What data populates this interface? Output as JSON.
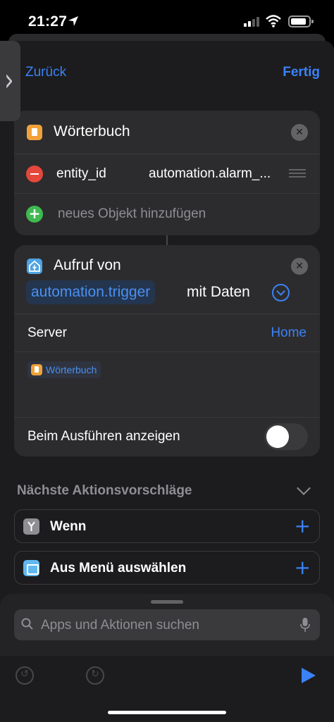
{
  "status_bar": {
    "time": "21:27"
  },
  "nav": {
    "back_label": "Zurück",
    "done_label": "Fertig"
  },
  "dictionary_card": {
    "title": "Wörterbuch",
    "entries": [
      {
        "key": "entity_id",
        "value": "automation.alarm_..."
      }
    ],
    "add_label": "neues Objekt hinzufügen"
  },
  "call_card": {
    "title": "Aufruf von",
    "service": "automation.trigger",
    "suffix": "mit Daten",
    "server_label": "Server",
    "server_value": "Home",
    "data_token": "Wörterbuch",
    "show_when_run_label": "Beim Ausführen anzeigen",
    "show_when_run": false
  },
  "suggestions": {
    "title": "Nächste Aktionsvorschläge",
    "items": [
      {
        "label": "Wenn",
        "icon": "if-icon"
      },
      {
        "label": "Aus Menü auswählen",
        "icon": "menu-icon"
      }
    ]
  },
  "search": {
    "placeholder": "Apps und Aktionen suchen"
  },
  "colors": {
    "accent": "#3b82f6",
    "remove": "#e5473b",
    "add": "#3fb950",
    "dictionary_icon": "#f0a23a",
    "ha_icon": "#4fa3e3"
  }
}
